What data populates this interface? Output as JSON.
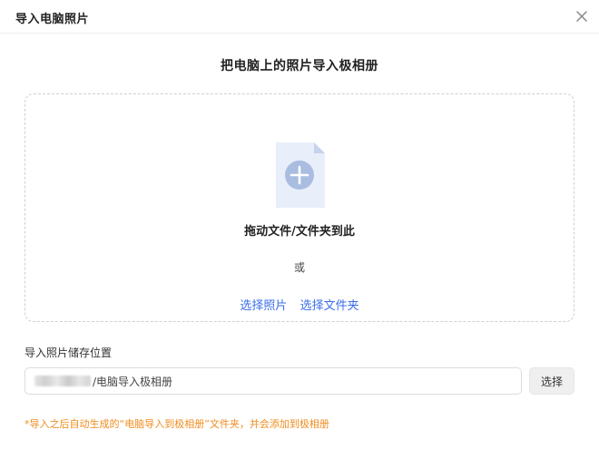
{
  "dialog": {
    "title": "导入电脑照片",
    "close_icon": "close-icon"
  },
  "main": {
    "heading": "把电脑上的照片导入极相册"
  },
  "dropzone": {
    "icon": "file-add-icon",
    "drop_text": "拖动文件/文件夹到此",
    "or_text": "或",
    "select_photos_link": "选择照片",
    "select_folder_link": "选择文件夹"
  },
  "storage": {
    "label": "导入照片储存位置",
    "path_suffix": "/电脑导入极相册",
    "choose_button": "选择"
  },
  "note": "*导入之后自动生成的“电脑导入到极相册”文件夹，并会添加到极相册",
  "colors": {
    "link": "#3a6ee8",
    "note": "#f08c1e",
    "icon_bg": "#e8eefa",
    "icon_circle": "#a9bde0"
  }
}
